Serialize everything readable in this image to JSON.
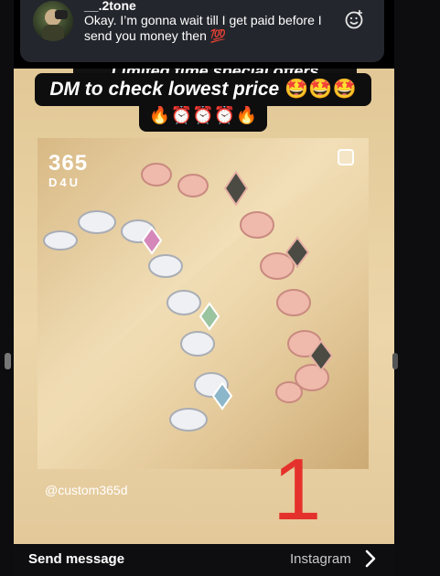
{
  "notification": {
    "username": "__.2tone",
    "message": "Okay. I’m gonna wait till I get paid before I send you money then 💯",
    "react_icon": "emoji-add-icon"
  },
  "story": {
    "banner_top_cut": "Limited time special offers",
    "banner_main": "DM to check lowest price",
    "banner_emojis": "🤩🤩🤩",
    "icons_row": "🔥⏰⏰⏰🔥",
    "brand_line1": "365",
    "brand_line2": "D4U",
    "watermark": "@custom365d",
    "overlay_number": "1"
  },
  "bottom_bar": {
    "send_label": "Send message",
    "platform_label": "Instagram",
    "next_icon": "chevron-right-icon"
  },
  "colors": {
    "story_bg": "#e7cf9f",
    "overlay_number": "#e5312b",
    "banner_bg": "#0e0e0e",
    "notification_bg": "#23262c"
  }
}
